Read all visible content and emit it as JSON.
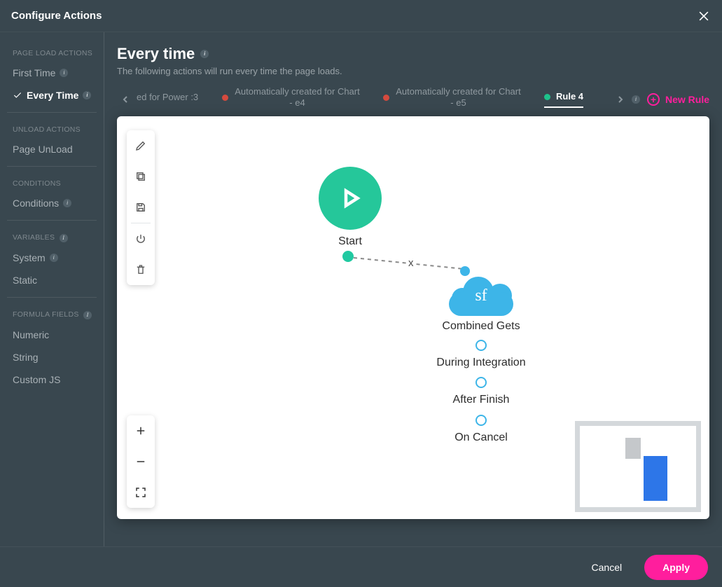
{
  "header": {
    "title": "Configure Actions"
  },
  "sidebar": {
    "groups": [
      {
        "heading": "PAGE LOAD ACTIONS",
        "items": [
          {
            "label": "First Time",
            "info": true,
            "active": false
          },
          {
            "label": "Every Time",
            "info": true,
            "active": true
          }
        ]
      },
      {
        "heading": "UNLOAD ACTIONS",
        "items": [
          {
            "label": "Page UnLoad",
            "info": false,
            "active": false
          }
        ]
      },
      {
        "heading": "CONDITIONS",
        "items": [
          {
            "label": "Conditions",
            "info": true,
            "active": false
          }
        ]
      },
      {
        "heading": "VARIABLES",
        "info": true,
        "items": [
          {
            "label": "System",
            "info": true,
            "active": false
          },
          {
            "label": "Static",
            "info": false,
            "active": false
          }
        ]
      },
      {
        "heading": "FORMULA FIELDS",
        "info": true,
        "items": [
          {
            "label": "Numeric",
            "info": false,
            "active": false
          },
          {
            "label": "String",
            "info": false,
            "active": false
          },
          {
            "label": "Custom JS",
            "info": false,
            "active": false
          }
        ]
      }
    ]
  },
  "main": {
    "title": "Every time",
    "subtitle": "The following actions will run every time the page loads."
  },
  "tabs": {
    "items": [
      {
        "label": "ed for Power :3",
        "status": null,
        "active": false,
        "truncated": true
      },
      {
        "label": "Automatically created for Chart - e4",
        "status": "red",
        "active": false
      },
      {
        "label": "Automatically created for Chart - e5",
        "status": "red",
        "active": false
      },
      {
        "label": "Rule 4",
        "status": "green",
        "active": true
      }
    ],
    "new_rule_label": "New Rule"
  },
  "canvas": {
    "start_label": "Start",
    "edge_delete": "x",
    "sf_node": {
      "cloud_text": "sf",
      "title": "Combined Gets",
      "during": "During Integration",
      "after": "After Finish",
      "cancel": "On Cancel"
    }
  },
  "footer": {
    "cancel": "Cancel",
    "apply": "Apply"
  },
  "icons": {
    "info": "i"
  }
}
